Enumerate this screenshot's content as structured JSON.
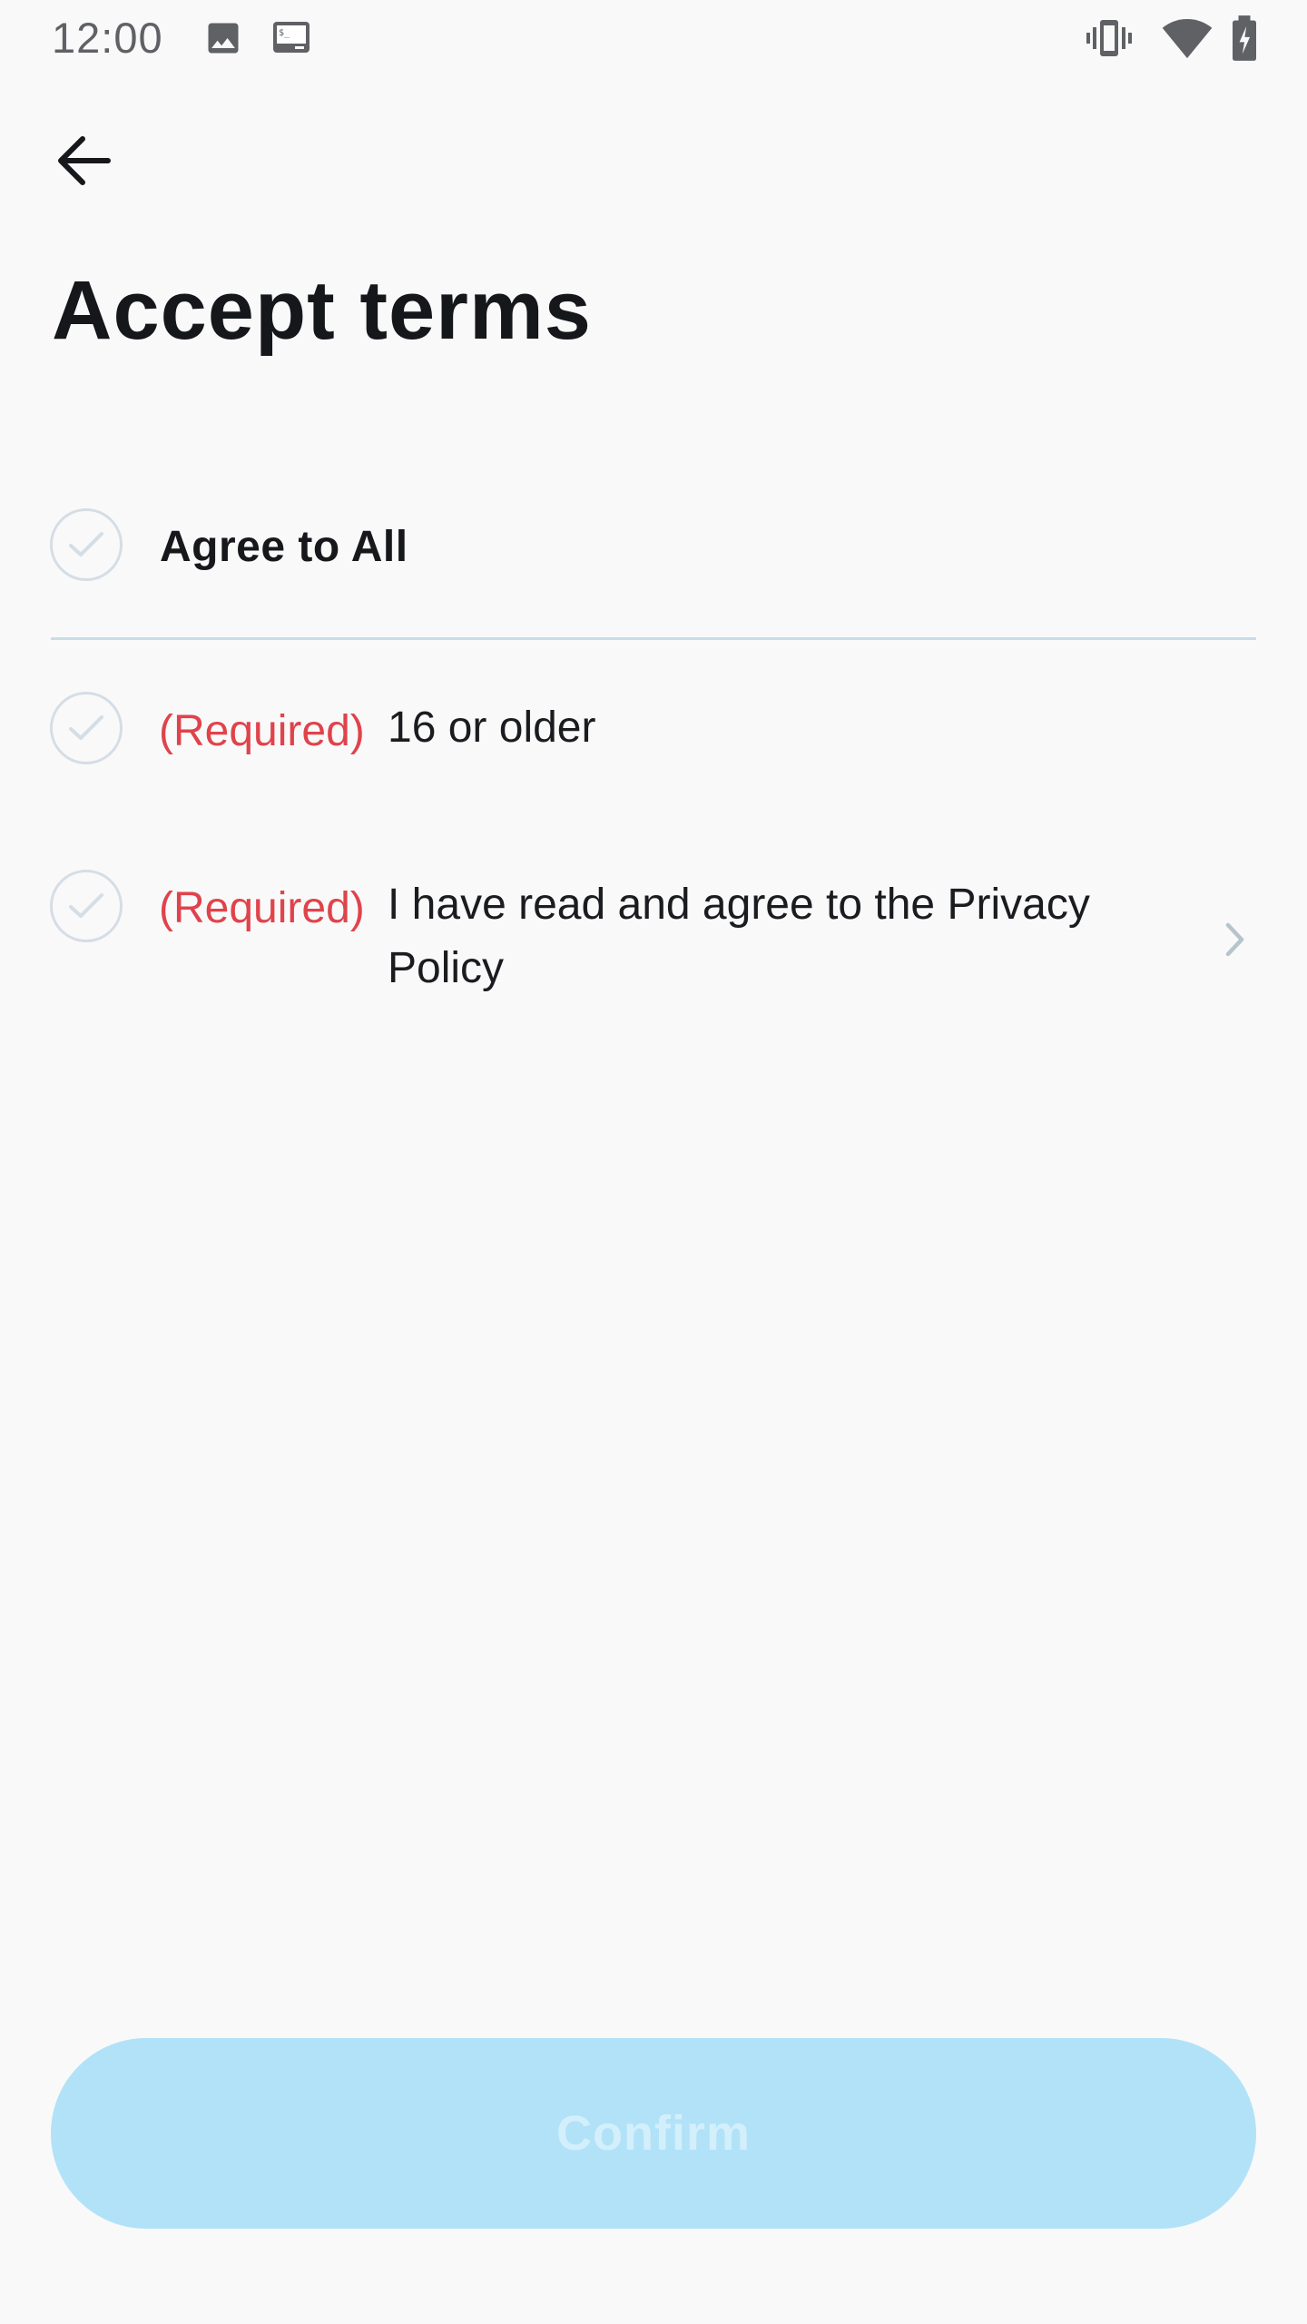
{
  "status_bar": {
    "time": "12:00",
    "left_icons": [
      "image-icon",
      "terminal-icon"
    ],
    "right_icons": [
      "vibrate-icon",
      "wifi-icon",
      "battery-charging-icon"
    ]
  },
  "header": {
    "back_icon": "arrow-left-icon",
    "title": "Accept terms"
  },
  "agree_all": {
    "label": "Agree to All",
    "checked": false
  },
  "terms": [
    {
      "required_label": "(Required)",
      "text": "16 or older",
      "checked": false,
      "has_detail": false
    },
    {
      "required_label": "(Required)",
      "text": "I have read and agree to the Privacy Policy",
      "checked": false,
      "has_detail": true
    }
  ],
  "confirm": {
    "label": "Confirm",
    "enabled": false
  },
  "colors": {
    "background": "#f9f9fa",
    "required_red": "#e0434b",
    "divider": "#c9dde8",
    "check_outline": "#d5dde5",
    "confirm_disabled_bg": "#b1e2f8",
    "confirm_disabled_text": "#d3effb"
  }
}
